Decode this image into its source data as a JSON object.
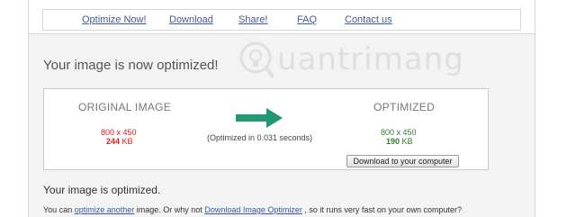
{
  "nav": {
    "items": [
      "Optimize Now!",
      "Download",
      "Share!",
      "FAQ",
      "Contact us"
    ]
  },
  "watermark": {
    "text": "uantrimang"
  },
  "heading": "Your image is now optimized!",
  "result": {
    "original": {
      "title": "ORIGINAL IMAGE",
      "dimensions": "800 x 450",
      "size": "244",
      "size_unit": "KB"
    },
    "optimized": {
      "title": "OPTIMIZED",
      "dimensions": "800 x 450",
      "size": "190",
      "size_unit": "KB"
    },
    "time_text": "(Optimized in 0.031 seconds)",
    "download_button": "Download to your computer"
  },
  "sub_heading": "Your image is optimized.",
  "bottom": {
    "prefix": "You can",
    "link1": "optimize another",
    "middle": "image. Or why not",
    "link2": "Download Image Optimizer",
    "suffix": ", so it runs very fast on your own computer?"
  },
  "colors": {
    "link": "#3b5b9c",
    "original_size": "#e02020",
    "optimized_size": "#2e7d2e",
    "arrow": "#1f9a74"
  }
}
